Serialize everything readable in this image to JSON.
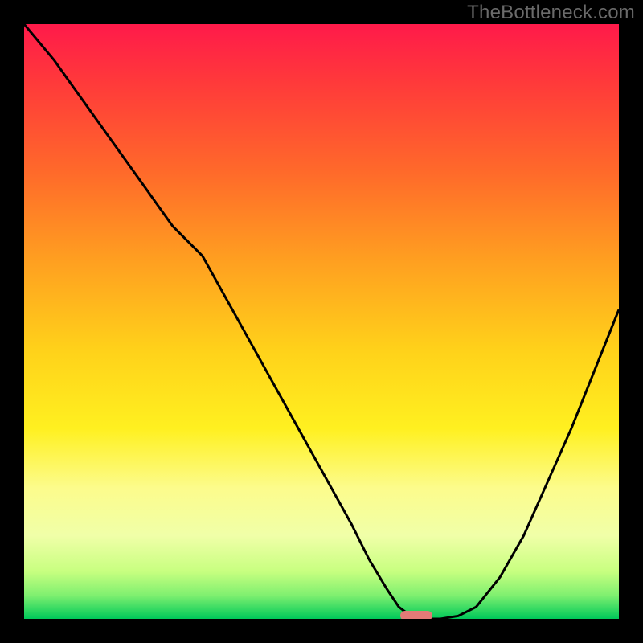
{
  "watermark": "TheBottleneck.com",
  "colors": {
    "page_bg": "#000000",
    "watermark": "#6a6a6a",
    "curve": "#000000",
    "marker": "#e37a77",
    "gradient_top": "#ff1a4a",
    "gradient_bottom": "#00c85a"
  },
  "chart_data": {
    "type": "line",
    "title": "",
    "xlabel": "",
    "ylabel": "",
    "xlim": [
      0,
      100
    ],
    "ylim": [
      0,
      100
    ],
    "grid": false,
    "legend": false,
    "x": [
      0,
      5,
      10,
      15,
      20,
      25,
      30,
      35,
      40,
      45,
      50,
      55,
      58,
      61,
      63,
      65,
      67,
      70,
      73,
      76,
      80,
      84,
      88,
      92,
      96,
      100
    ],
    "values": [
      100,
      94,
      87,
      80,
      73,
      66,
      61,
      52,
      43,
      34,
      25,
      16,
      10,
      5,
      2,
      0.5,
      0,
      0,
      0.5,
      2,
      7,
      14,
      23,
      32,
      42,
      52
    ],
    "annotations": [
      {
        "type": "marker",
        "shape": "rounded-rect",
        "x": 66,
        "y": 0,
        "color": "#e37a77"
      }
    ],
    "background": {
      "type": "vertical-gradient",
      "stops": [
        {
          "pos": 0.0,
          "color": "#ff1a4a"
        },
        {
          "pos": 0.25,
          "color": "#ff6a2a"
        },
        {
          "pos": 0.55,
          "color": "#ffd21a"
        },
        {
          "pos": 0.78,
          "color": "#fcfc8c"
        },
        {
          "pos": 0.96,
          "color": "#80f070"
        },
        {
          "pos": 1.0,
          "color": "#00c85a"
        }
      ]
    }
  }
}
